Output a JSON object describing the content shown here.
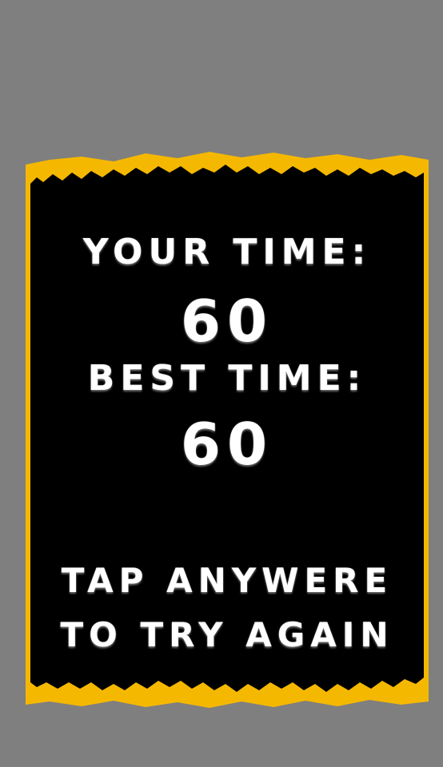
{
  "results": {
    "your_time_label": "YOUR TIME:",
    "your_time_value": "60",
    "best_time_label": "BEST TIME:",
    "best_time_value": "60"
  },
  "prompt": {
    "line1": "TAP ANYWERE",
    "line2": "TO TRY AGAIN"
  },
  "colors": {
    "background": "#7f7f7f",
    "panel": "#000000",
    "border": "#f5b800",
    "text": "#ffffff"
  }
}
